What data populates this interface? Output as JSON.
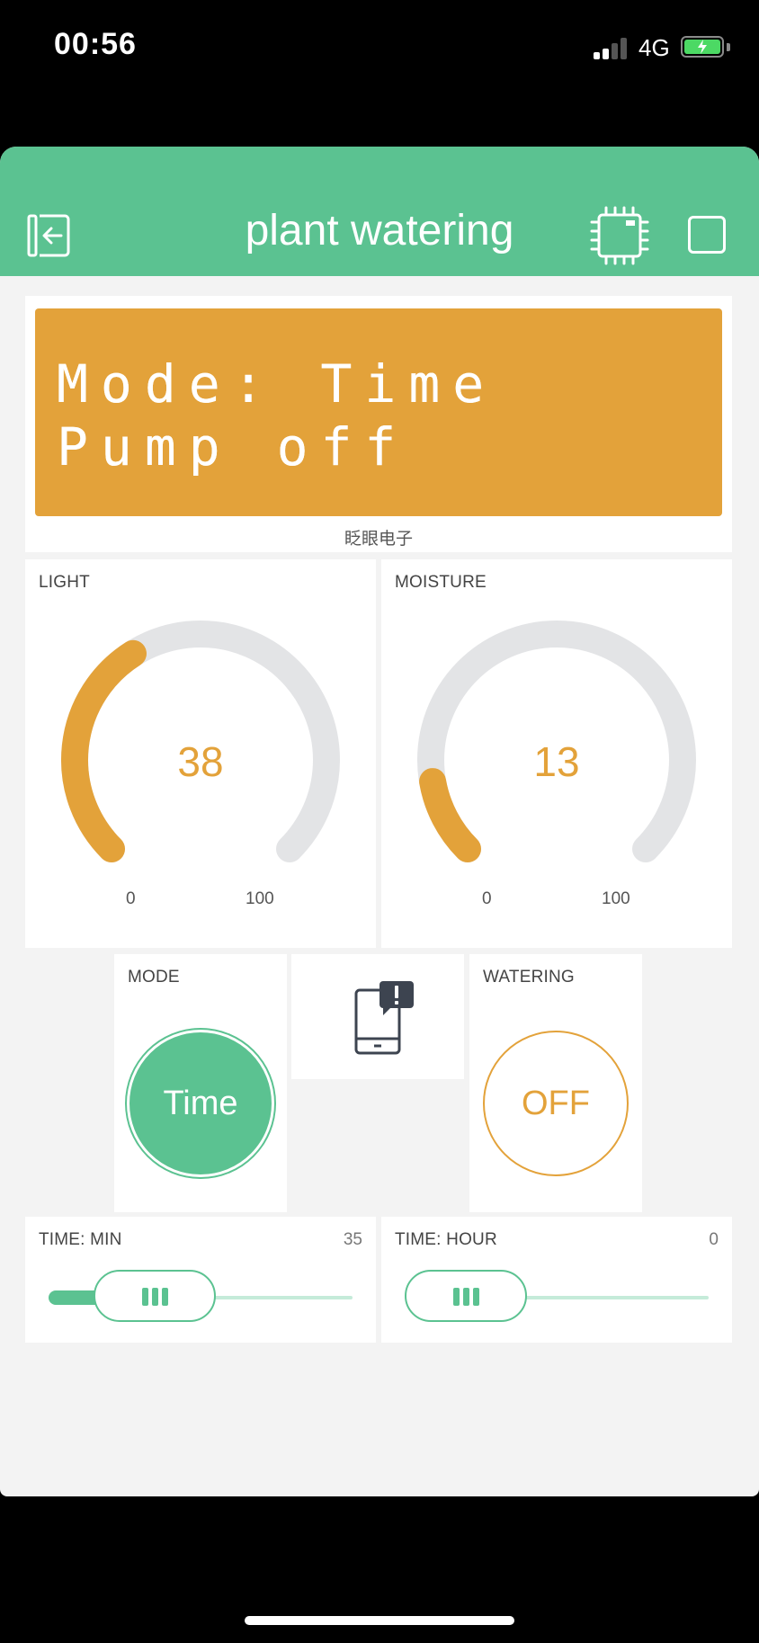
{
  "status_bar": {
    "time": "00:56",
    "network": "4G"
  },
  "header": {
    "title": "plant watering",
    "color": "#5bc291"
  },
  "lcd": {
    "line1": "Mode: Time",
    "line2": "Pump off",
    "footer": "眨眼电子",
    "color": "#e3a23a"
  },
  "gauges": {
    "light": {
      "label": "LIGHT",
      "value": "38",
      "min": "0",
      "max": "100",
      "fraction": 0.38
    },
    "moisture": {
      "label": "MOISTURE",
      "value": "13",
      "min": "0",
      "max": "100",
      "fraction": 0.13
    }
  },
  "mode": {
    "label": "MODE",
    "button": "Time"
  },
  "notification": {
    "icon": "phone-notification-icon"
  },
  "watering": {
    "label": "WATERING",
    "button": "OFF"
  },
  "sliders": {
    "minute": {
      "label": "TIME: MIN",
      "value": "35",
      "fraction": 0.35
    },
    "hour": {
      "label": "TIME: HOUR",
      "value": "0",
      "fraction": 0.0
    }
  },
  "colors": {
    "accent_green": "#5bc291",
    "accent_orange": "#e3a23a",
    "track_gray": "#e3e4e6"
  }
}
